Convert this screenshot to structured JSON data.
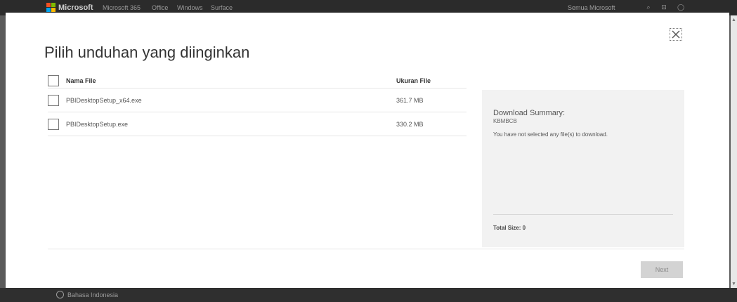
{
  "header": {
    "brand": "Microsoft",
    "nav": [
      "Microsoft 365",
      "Office",
      "Windows",
      "Surface"
    ],
    "right_link": "Semua Microsoft",
    "logo_colors": [
      "#f25022",
      "#7fba00",
      "#00a4ef",
      "#ffb900"
    ]
  },
  "modal": {
    "title": "Pilih unduhan yang diinginkan",
    "table": {
      "col_name": "Nama File",
      "col_size": "Ukuran File",
      "rows": [
        {
          "name": "PBIDesktopSetup_x64.exe",
          "size": "361.7 MB"
        },
        {
          "name": "PBIDesktopSetup.exe",
          "size": "330.2 MB"
        }
      ]
    },
    "summary": {
      "title": "Download Summary:",
      "code": "KBMBCB",
      "message": "You have not selected any file(s) to download.",
      "total": "Total Size: 0"
    },
    "next_label": "Next"
  },
  "footer": {
    "language": "Bahasa Indonesia"
  }
}
